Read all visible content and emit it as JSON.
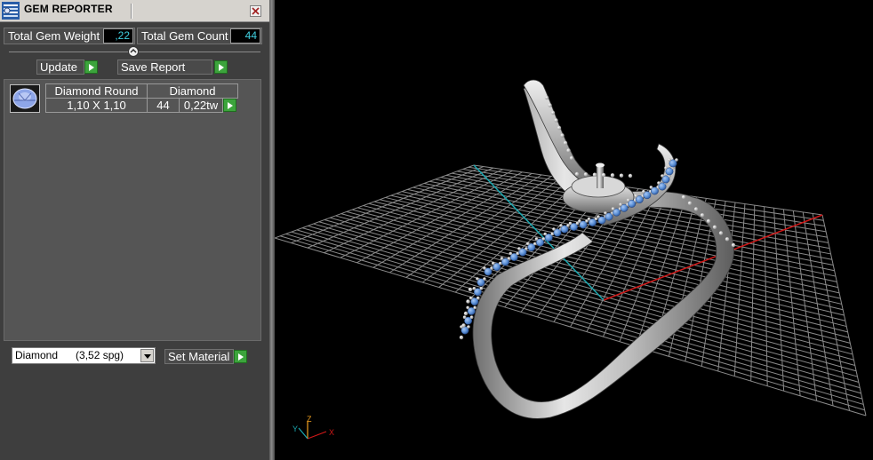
{
  "window": {
    "title": "GEM REPORTER"
  },
  "summary": {
    "total_weight_label": "Total Gem Weight",
    "total_weight_value": ",22",
    "total_count_label": "Total Gem Count",
    "total_count_value": "44"
  },
  "toolbar": {
    "update_label": "Update",
    "save_report_label": "Save Report"
  },
  "gems": [
    {
      "shape": "Diamond Round",
      "material": "Diamond",
      "size": "1,10 X 1,10",
      "count": "44",
      "weight": "0,22tw"
    }
  ],
  "material_picker": {
    "selected": "Diamond      (3,52 spg)",
    "set_label": "Set Material"
  },
  "viewport": {
    "axis_z": "Z",
    "axis_x": "X",
    "axis_y": "Y",
    "colors": {
      "grid": "#8a8a8a",
      "x_axis": "#d01818",
      "y_axis": "#1aa8b0",
      "metal": "#c8c8c8",
      "stone": "#5a8fd6"
    }
  },
  "colors": {
    "panel_bg": "#3e3e3e",
    "value_text": "#40d0e0",
    "play_green": "#3ca43c"
  }
}
